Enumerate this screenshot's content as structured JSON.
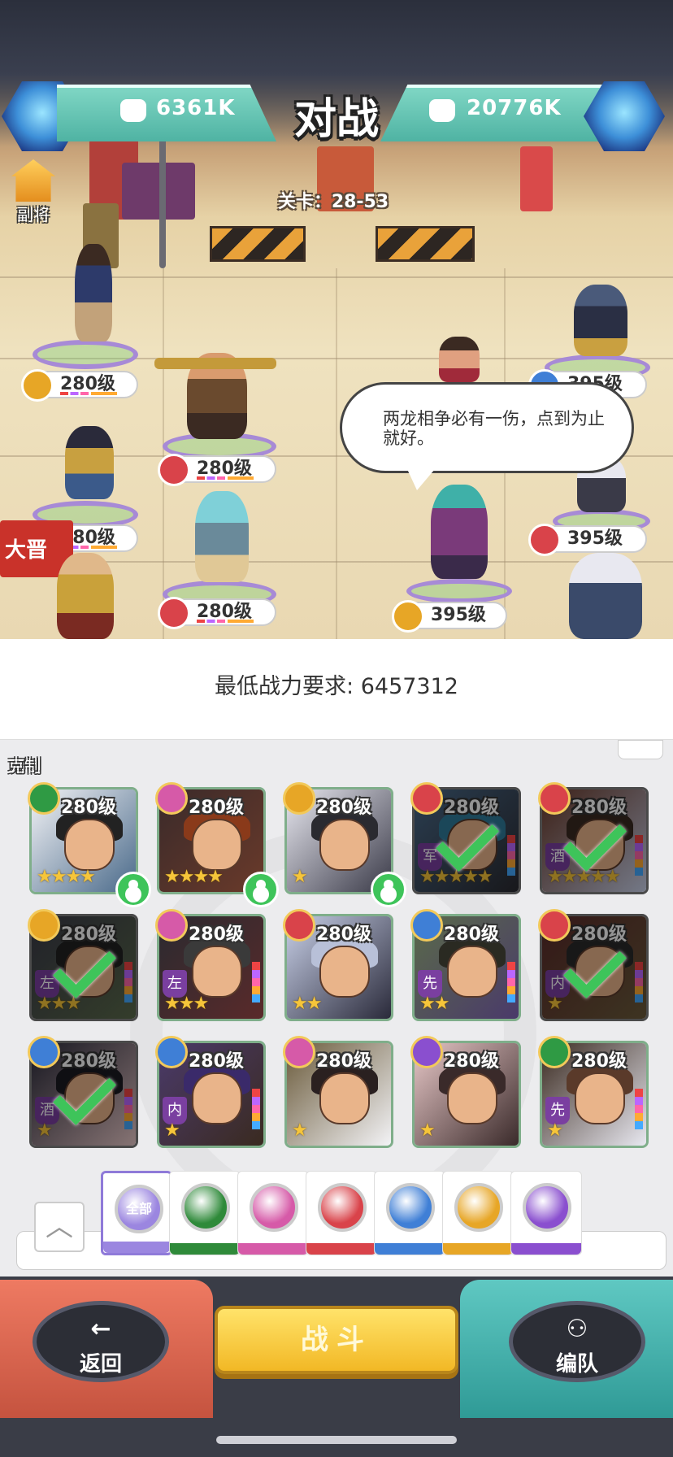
{
  "battle": {
    "title": "对战",
    "left_power": "6361K",
    "right_power": "20776K",
    "stage": "关卡：28-53",
    "sub_general_label": "副将",
    "speech": "两龙相争必有一伤，点到为止就好。",
    "left_team": [
      {
        "level": "280级",
        "faction": "sun"
      },
      {
        "level": "280级",
        "faction": "club"
      },
      {
        "level": "280级",
        "faction": "club"
      },
      {
        "level": "280级",
        "faction": "club"
      }
    ],
    "right_team": [
      {
        "level": "395级",
        "faction": "diamond"
      },
      {
        "level": "395级",
        "faction": "club"
      },
      {
        "level": "395级",
        "faction": "sun"
      }
    ],
    "banner_text": "大晋"
  },
  "requirement": "最低战力要求: 6457312",
  "counter_label": "克制",
  "roster": [
    {
      "level": "280级",
      "stars": "★★★★",
      "faction": "spade",
      "friend": true,
      "selected": false,
      "tag": ""
    },
    {
      "level": "280级",
      "stars": "★★★★",
      "faction": "heart",
      "friend": true,
      "selected": false,
      "tag": ""
    },
    {
      "level": "280级",
      "stars": "★",
      "faction": "sun",
      "friend": true,
      "selected": false,
      "tag": ""
    },
    {
      "level": "280级",
      "stars": "★★★★★",
      "faction": "club",
      "friend": false,
      "selected": true,
      "tag": "军"
    },
    {
      "level": "280级",
      "stars": "★★★★★",
      "faction": "club",
      "friend": false,
      "selected": true,
      "tag": "酒"
    },
    {
      "level": "280级",
      "stars": "★★★",
      "faction": "sun",
      "friend": false,
      "selected": true,
      "tag": "左"
    },
    {
      "level": "280级",
      "stars": "★★★",
      "faction": "heart",
      "friend": false,
      "selected": false,
      "tag": "左"
    },
    {
      "level": "280级",
      "stars": "★★",
      "faction": "club",
      "friend": false,
      "selected": false,
      "tag": ""
    },
    {
      "level": "280级",
      "stars": "★★",
      "faction": "diamond",
      "friend": false,
      "selected": false,
      "tag": "先"
    },
    {
      "level": "280级",
      "stars": "★",
      "faction": "club",
      "friend": false,
      "selected": true,
      "tag": "内"
    },
    {
      "level": "280级",
      "stars": "★",
      "faction": "diamond",
      "friend": false,
      "selected": true,
      "tag": "酒"
    },
    {
      "level": "280级",
      "stars": "★",
      "faction": "diamond",
      "friend": false,
      "selected": false,
      "tag": "内"
    },
    {
      "level": "280级",
      "stars": "★",
      "faction": "heart",
      "friend": false,
      "selected": false,
      "tag": ""
    },
    {
      "level": "280级",
      "stars": "★",
      "faction": "moon",
      "friend": false,
      "selected": false,
      "tag": ""
    },
    {
      "level": "280级",
      "stars": "★",
      "faction": "spade",
      "friend": false,
      "selected": false,
      "tag": "先"
    }
  ],
  "filters": [
    {
      "name": "all",
      "label": "全部",
      "color": "#9b86e0"
    },
    {
      "name": "spade",
      "label": "",
      "color": "#2f8a3a"
    },
    {
      "name": "heart",
      "label": "",
      "color": "#d65aa8"
    },
    {
      "name": "club",
      "label": "",
      "color": "#d9434a"
    },
    {
      "name": "diamond",
      "label": "",
      "color": "#3f7fd6"
    },
    {
      "name": "sun",
      "label": "",
      "color": "#e7a626"
    },
    {
      "name": "moon",
      "label": "",
      "color": "#8a4fcf"
    }
  ],
  "faction_colors": {
    "spade": "#2f9a44",
    "heart": "#d65aa8",
    "club": "#d9434a",
    "diamond": "#3f7fd6",
    "sun": "#e7a626",
    "moon": "#8a4fcf"
  },
  "buttons": {
    "back_label": "返回",
    "fight_label": "战斗",
    "formation_label": "编队"
  }
}
